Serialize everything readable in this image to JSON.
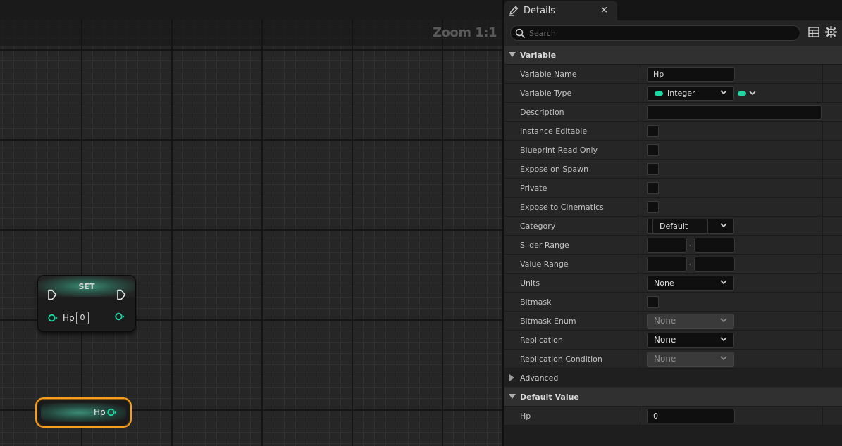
{
  "graph": {
    "zoom_label": "Zoom 1:1",
    "set_node": {
      "title": "SET",
      "pin_label": "Hp",
      "pin_value": "0"
    },
    "get_node": {
      "pin_label": "Hp"
    }
  },
  "details": {
    "tab_title": "Details",
    "tab_close": "×",
    "search_placeholder": "Search",
    "sections": {
      "variable": "Variable",
      "advanced": "Advanced",
      "default_value": "Default Value"
    },
    "props": {
      "variable_name": {
        "label": "Variable Name",
        "value": "Hp"
      },
      "variable_type": {
        "label": "Variable Type",
        "value": "Integer"
      },
      "description": {
        "label": "Description",
        "value": ""
      },
      "instance_editable": {
        "label": "Instance Editable"
      },
      "blueprint_read_only": {
        "label": "Blueprint Read Only"
      },
      "expose_on_spawn": {
        "label": "Expose on Spawn"
      },
      "private": {
        "label": "Private"
      },
      "expose_to_cinematics": {
        "label": "Expose to Cinematics"
      },
      "category": {
        "label": "Category",
        "value": "Default"
      },
      "slider_range": {
        "label": "Slider Range",
        "min": "",
        "max": ""
      },
      "value_range": {
        "label": "Value Range",
        "min": "",
        "max": ""
      },
      "units": {
        "label": "Units",
        "value": "None"
      },
      "bitmask": {
        "label": "Bitmask"
      },
      "bitmask_enum": {
        "label": "Bitmask Enum",
        "value": "None"
      },
      "replication": {
        "label": "Replication",
        "value": "None"
      },
      "replication_condition": {
        "label": "Replication Condition",
        "value": "None"
      },
      "default_hp": {
        "label": "Hp",
        "value": "0"
      }
    },
    "colors": {
      "integer_pin": "#1ed9a3",
      "selection_outline": "#f59d1c"
    }
  }
}
